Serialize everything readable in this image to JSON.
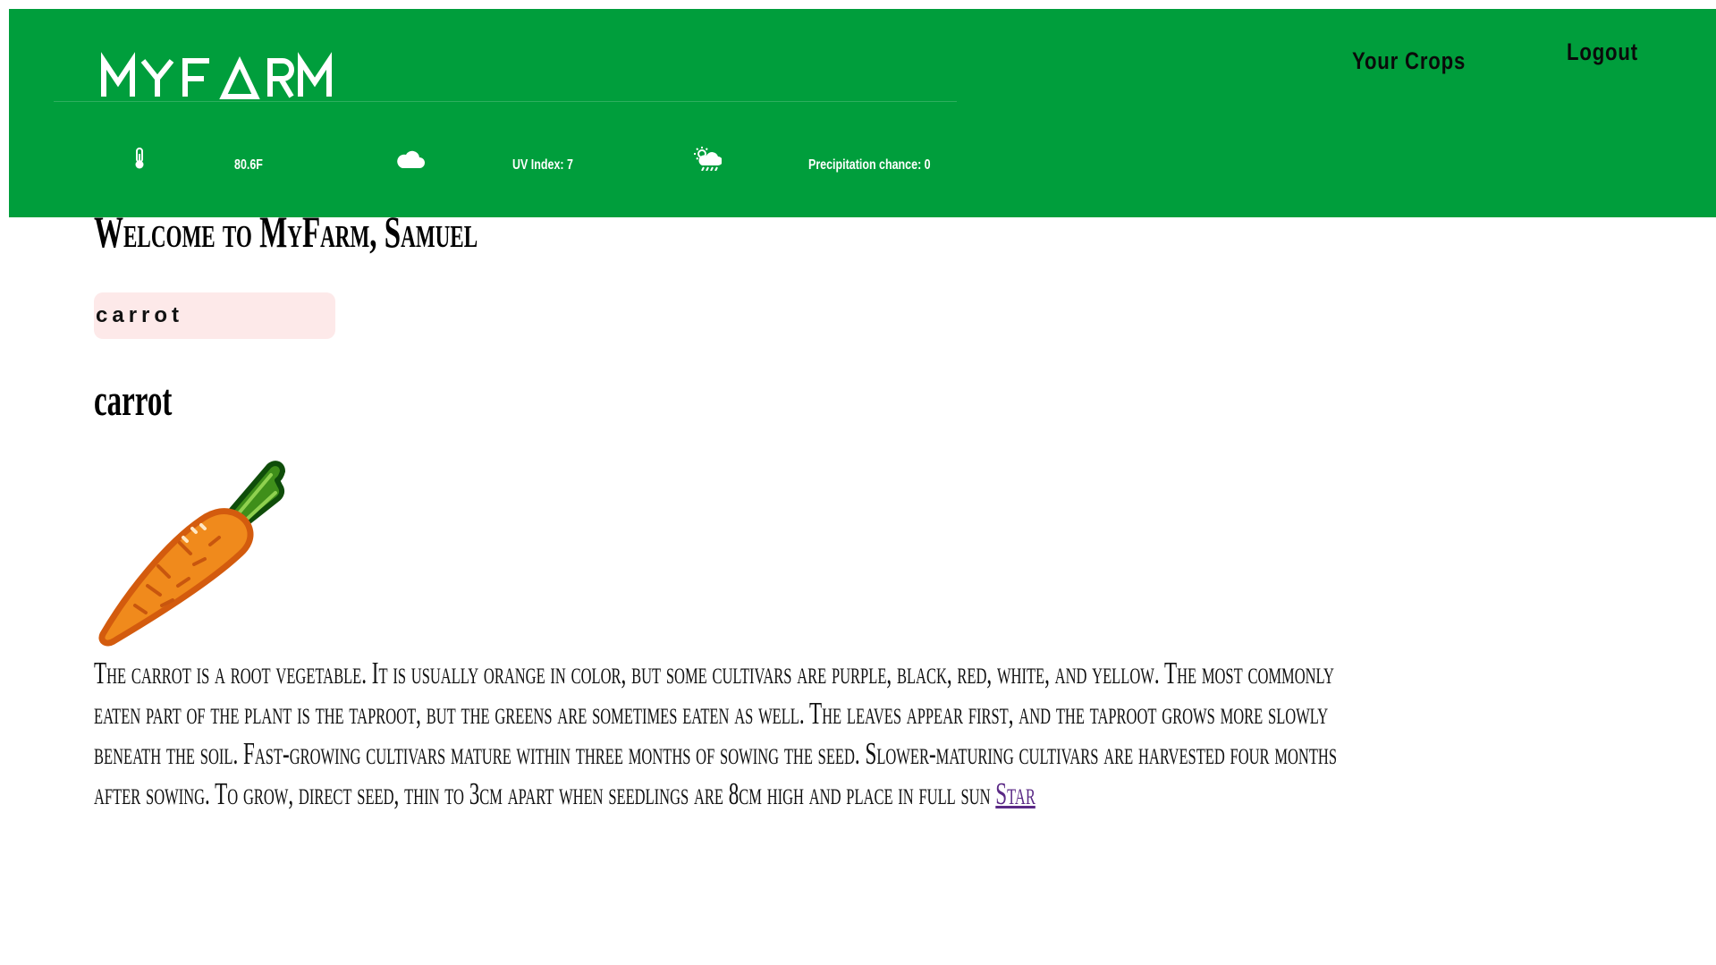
{
  "app": {
    "logo_text": "MYFARM"
  },
  "nav": {
    "crops_label": "Your Crops",
    "logout_label": "Logout"
  },
  "weather": {
    "temperature": "80.6F",
    "temperature_icon": "thermometer-icon",
    "uv_index": "UV Index: 7",
    "uv_icon": "cloud-icon",
    "precipitation": "Precipitation chance: 0",
    "precipitation_icon": "sun-rain-icon"
  },
  "main": {
    "welcome": "Welcome to MyFarm, Samuel",
    "search": {
      "value": "carrot",
      "placeholder": ""
    },
    "crop": {
      "title": "carrot",
      "image_icon": "carrot-icon",
      "description": "The carrot is a root vegetable. It is usually orange in color, but some cultivars are purple, black, red, white, and yellow. The most commonly eaten part of the plant is the taproot, but the greens are sometimes eaten as well. The leaves appear first, and the taproot grows more slowly beneath the soil. Fast-growing cultivars mature within three months of sowing the seed. Slower-maturing cultivars are harvested four months after sowing. To grow, direct seed, thin to 3cm apart when seedlings are 8cm high and place in full sun",
      "star_link": "Star"
    }
  },
  "colors": {
    "header_bg": "#009e3c",
    "search_bg": "#fde9e9",
    "link": "#5b2a86",
    "carrot_orange": "#f08a1c",
    "carrot_green": "#3f8f1a"
  }
}
